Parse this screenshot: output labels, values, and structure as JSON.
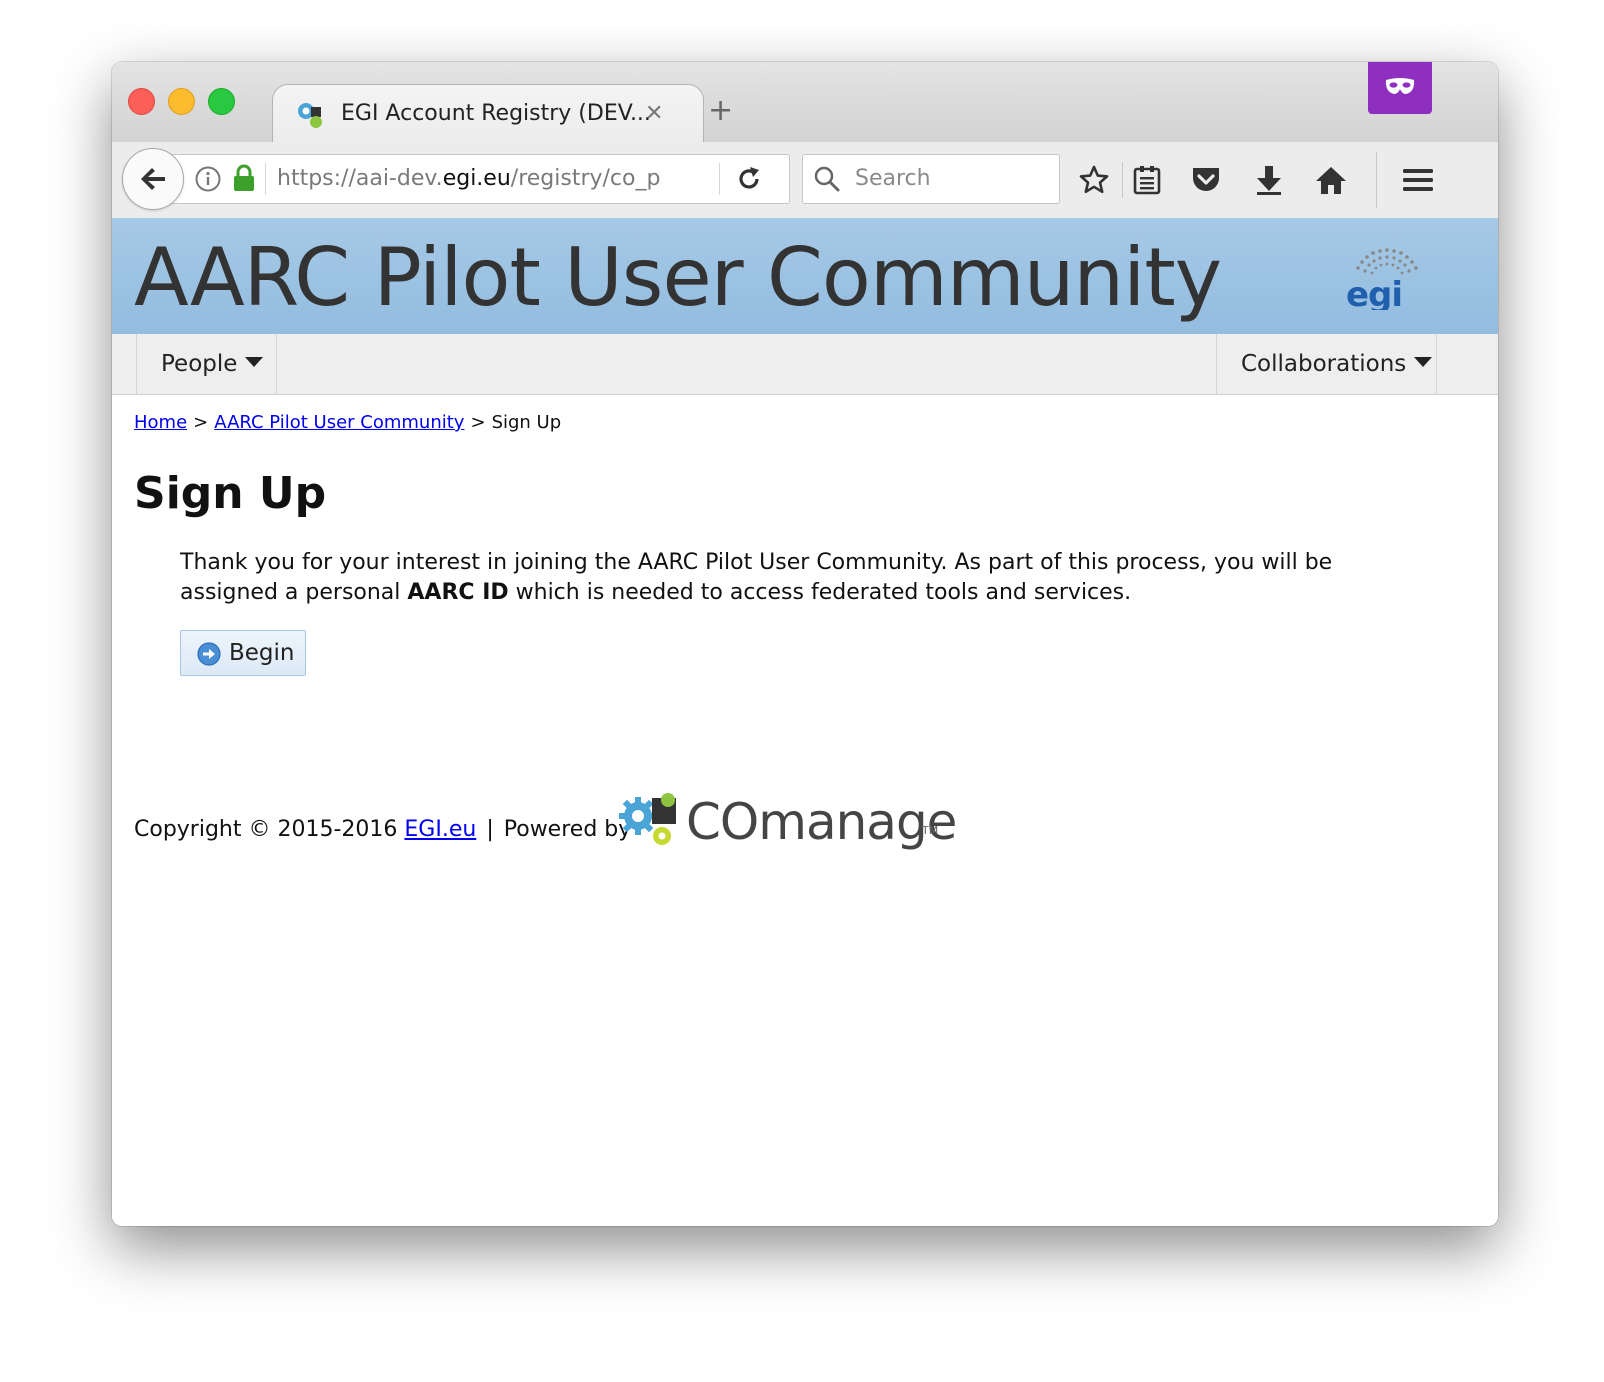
{
  "browser": {
    "tab_title": "EGI Account Registry (DEV...",
    "tab_close": "✕",
    "new_tab": "+",
    "url_prefix": "https://aai-dev.",
    "url_domain": "egi.eu",
    "url_path": "/registry/co_p",
    "search_placeholder": "Search"
  },
  "banner": {
    "title": "AARC Pilot User Community"
  },
  "menu": {
    "people": "People",
    "collaborations": "Collaborations"
  },
  "breadcrumb": {
    "home": "Home",
    "sep1": ">",
    "community": "AARC Pilot User Community",
    "sep2": ">",
    "current": "Sign Up"
  },
  "main": {
    "title": "Sign Up",
    "intro_before": "Thank you for your interest in joining the AARC Pilot User Community. As part of this process, you will be assigned a personal ",
    "intro_bold": "AARC ID",
    "intro_after": " which is needed to access federated tools and services.",
    "begin_label": "Begin"
  },
  "footer": {
    "copyright": "Copyright © 2015-2016 ",
    "egi_link": "EGI.eu",
    "pipe": "|",
    "powered_by": "Powered by",
    "comanage_word": "COmanage",
    "comanage_tm": "TM"
  },
  "colors": {
    "banner": "#9ec4e4",
    "link": "#0000ee",
    "mask_button": "#8e2fbf"
  },
  "icons": [
    "back-arrow-icon",
    "info-icon",
    "lock-icon",
    "reload-icon",
    "search-icon",
    "bookmark-star-icon",
    "reading-list-icon",
    "pocket-icon",
    "download-icon",
    "home-icon",
    "hamburger-menu-icon",
    "private-mask-icon",
    "egi-logo",
    "comanage-gears-logo",
    "arrow-circle-icon"
  ]
}
